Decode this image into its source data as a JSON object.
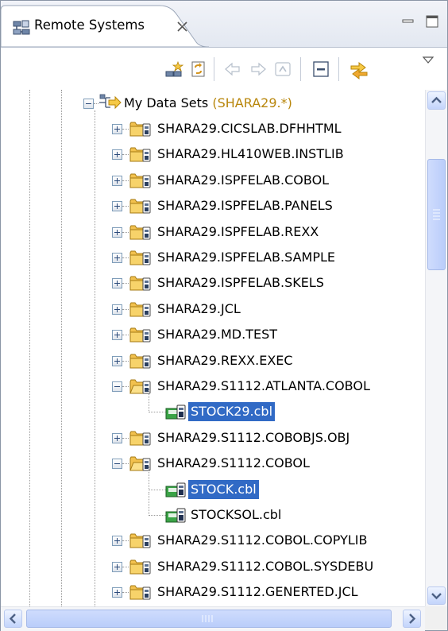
{
  "view": {
    "tab_title": "Remote Systems",
    "tab_icon": "remote-systems-icon",
    "close_icon": "close-icon",
    "minimize_icon": "minimize-icon",
    "maximize_icon": "maximize-icon"
  },
  "toolbar": {
    "buttons": [
      {
        "name": "new-connection-icon",
        "enabled": true
      },
      {
        "name": "refresh-icon",
        "enabled": true
      },
      {
        "name": "back-icon",
        "enabled": false
      },
      {
        "name": "forward-icon",
        "enabled": false
      },
      {
        "name": "up-icon",
        "enabled": false
      },
      {
        "name": "collapse-all-icon",
        "enabled": true
      },
      {
        "name": "link-with-editor-icon",
        "enabled": true
      },
      {
        "name": "view-menu-icon",
        "enabled": true
      }
    ]
  },
  "tree": {
    "root": {
      "label": "My Data Sets",
      "filter": "(SHARA29.*)",
      "expanded": true,
      "icon": "filter-icon"
    },
    "items": [
      {
        "label": "SHARA29.CICSLAB.DFHHTML",
        "type": "pds",
        "expanded": false,
        "selected": false
      },
      {
        "label": "SHARA29.HL410WEB.INSTLIB",
        "type": "pds",
        "expanded": false,
        "selected": false
      },
      {
        "label": "SHARA29.ISPFELAB.COBOL",
        "type": "pds",
        "expanded": false,
        "selected": false
      },
      {
        "label": "SHARA29.ISPFELAB.PANELS",
        "type": "pds",
        "expanded": false,
        "selected": false
      },
      {
        "label": "SHARA29.ISPFELAB.REXX",
        "type": "pds",
        "expanded": false,
        "selected": false
      },
      {
        "label": "SHARA29.ISPFELAB.SAMPLE",
        "type": "pds",
        "expanded": false,
        "selected": false
      },
      {
        "label": "SHARA29.ISPFELAB.SKELS",
        "type": "pds",
        "expanded": false,
        "selected": false
      },
      {
        "label": "SHARA29.JCL",
        "type": "pds",
        "expanded": false,
        "selected": false
      },
      {
        "label": "SHARA29.MD.TEST",
        "type": "pds",
        "expanded": false,
        "selected": false
      },
      {
        "label": "SHARA29.REXX.EXEC",
        "type": "pds",
        "expanded": false,
        "selected": false
      },
      {
        "label": "SHARA29.S1112.ATLANTA.COBOL",
        "type": "pds",
        "expanded": true,
        "selected": false
      },
      {
        "label": "STOCK29.cbl",
        "type": "member",
        "selected": true,
        "last": true
      },
      {
        "label": "SHARA29.S1112.COBOBJS.OBJ",
        "type": "pds",
        "expanded": false,
        "selected": false
      },
      {
        "label": "SHARA29.S1112.COBOL",
        "type": "pds",
        "expanded": true,
        "selected": false
      },
      {
        "label": "STOCK.cbl",
        "type": "member",
        "selected": true,
        "last": false
      },
      {
        "label": "STOCKSOL.cbl",
        "type": "member",
        "selected": false,
        "last": true
      },
      {
        "label": "SHARA29.S1112.COBOL.COPYLIB",
        "type": "pds",
        "expanded": false,
        "selected": false
      },
      {
        "label": "SHARA29.S1112.COBOL.SYSDEBU",
        "type": "pds",
        "expanded": false,
        "selected": false
      },
      {
        "label": "SHARA29.S1112.GENERTED.JCL",
        "type": "pds",
        "expanded": false,
        "selected": false
      }
    ]
  },
  "colors": {
    "selection": "#316ac5",
    "filter_text": "#b8860b",
    "folder": "#f2c14e",
    "member": "#2e7d32"
  }
}
